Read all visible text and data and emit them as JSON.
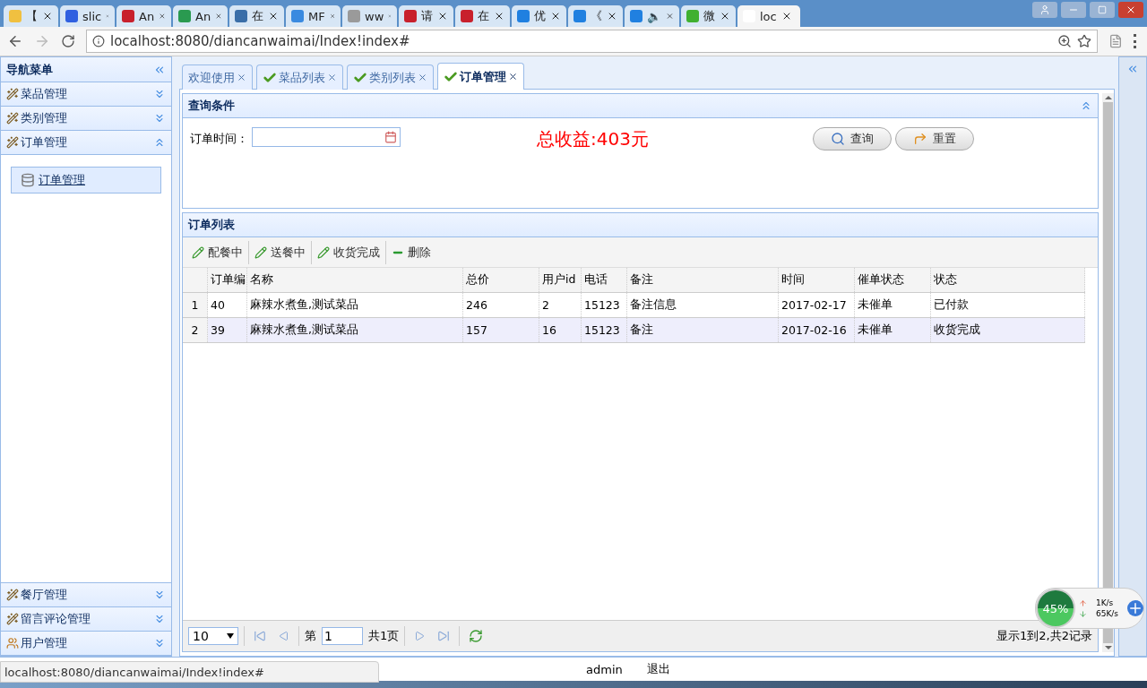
{
  "browser": {
    "tabs": [
      {
        "label": "【",
        "color": "#f0c040",
        "selected": false
      },
      {
        "label": "slic",
        "color": "#3060e0",
        "selected": false
      },
      {
        "label": "An",
        "color": "#c8202c",
        "selected": false
      },
      {
        "label": "An",
        "color": "#2a9a50",
        "selected": false
      },
      {
        "label": "在",
        "color": "#3a6ea8",
        "selected": false
      },
      {
        "label": "MF",
        "color": "#3a8ae0",
        "selected": false
      },
      {
        "label": "ww",
        "color": "#9a9a9a",
        "selected": false
      },
      {
        "label": "请",
        "color": "#c8202c",
        "selected": false
      },
      {
        "label": "在",
        "color": "#c8202c",
        "selected": false
      },
      {
        "label": "优",
        "color": "#2080e0",
        "selected": false
      },
      {
        "label": "《",
        "color": "#2080e0",
        "selected": false
      },
      {
        "label": "🔈",
        "color": "#2080e0",
        "selected": false
      },
      {
        "label": "微",
        "color": "#40b030",
        "selected": false
      },
      {
        "label": "loc",
        "color": "#ffffff",
        "selected": true
      }
    ],
    "address": "localhost:8080/diancanwaimai/Index!index#",
    "status_url": "localhost:8080/diancanwaimai/Index!index#"
  },
  "sidebar": {
    "title": "导航菜单",
    "sections": [
      {
        "label": "菜品管理",
        "kind": "wand",
        "expanded": false
      },
      {
        "label": "类别管理",
        "kind": "wand",
        "expanded": false
      },
      {
        "label": "订单管理",
        "kind": "wand",
        "expanded": true,
        "children": [
          {
            "label": "订单管理",
            "selected": true
          }
        ]
      },
      {
        "label": "餐厅管理",
        "kind": "wand",
        "expanded": false
      },
      {
        "label": "留言评论管理",
        "kind": "wand",
        "expanded": false
      },
      {
        "label": "用户管理",
        "kind": "users",
        "expanded": false
      }
    ]
  },
  "tabs": [
    {
      "label": "欢迎使用",
      "has_check": false,
      "selected": false
    },
    {
      "label": "菜品列表",
      "has_check": true,
      "selected": false
    },
    {
      "label": "类别列表",
      "has_check": true,
      "selected": false
    },
    {
      "label": "订单管理",
      "has_check": true,
      "selected": true
    }
  ],
  "query": {
    "title": "查询条件",
    "field_label": "订单时间：",
    "total": "总收益:403元",
    "buttons": [
      {
        "label": "查询",
        "kind": "search"
      },
      {
        "label": "重置",
        "kind": "reset"
      }
    ]
  },
  "orders": {
    "title": "订单列表",
    "toolbar": [
      {
        "label": "配餐中",
        "kind": "edit"
      },
      {
        "label": "送餐中",
        "kind": "edit"
      },
      {
        "label": "收货完成",
        "kind": "edit"
      },
      {
        "label": "删除",
        "kind": "delete"
      }
    ],
    "columns": [
      "订单编",
      "名称",
      "总价",
      "用户id",
      "电话",
      "备注",
      "时间",
      "催单状态",
      "状态"
    ],
    "rows": [
      {
        "number": "1",
        "selected": false,
        "cells": [
          "40",
          "麻辣水煮鱼,测试菜品",
          "246",
          "2",
          "15123",
          "备注信息",
          "2017-02-17",
          "未催单",
          "已付款"
        ]
      },
      {
        "number": "2",
        "selected": true,
        "cells": [
          "39",
          "麻辣水煮鱼,测试菜品",
          "157",
          "16",
          "15123",
          "备注",
          "2017-02-16",
          "未催单",
          "收货完成"
        ]
      }
    ],
    "pager": {
      "page_size": "10",
      "page_prefix": "第",
      "page": "1",
      "page_suffix": "共1页",
      "summary": "显示1到2,共2记录"
    }
  },
  "footer": {
    "user": "admin",
    "logout": "退出"
  },
  "net_widget": {
    "percent": "45%",
    "up": "1K/s",
    "down": "65K/s"
  }
}
